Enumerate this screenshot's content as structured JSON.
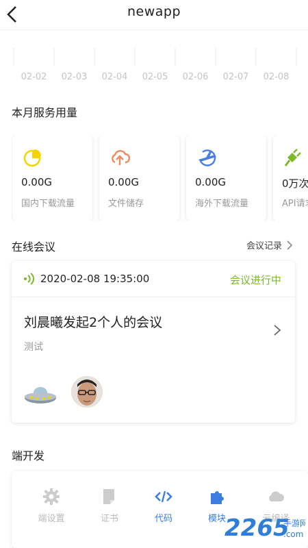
{
  "header": {
    "title": "newapp"
  },
  "chart": {
    "dates": [
      "02-02",
      "02-03",
      "02-04",
      "02-05",
      "02-06",
      "02-07",
      "02-08"
    ]
  },
  "usage": {
    "title": "本月服务用量",
    "cards": [
      {
        "value": "0.00G",
        "label": "国内下载流量",
        "icon": "pie-chart-icon",
        "color": "#f5d300"
      },
      {
        "value": "0.00G",
        "label": "文件储存",
        "icon": "cloud-upload-icon",
        "color": "#f08a5d"
      },
      {
        "value": "0.00G",
        "label": "海外下载流量",
        "icon": "globe-plane-icon",
        "color": "#4a7fe0"
      },
      {
        "value": "0万次",
        "label": "API请求",
        "icon": "plug-icon",
        "color": "#7bb928"
      }
    ]
  },
  "meeting": {
    "title": "在线会议",
    "link": "会议记录",
    "time": "2020-02-08 19:35:00",
    "status": "会议进行中",
    "name": "刘晨曦发起2个人的会议",
    "subtitle": "测试",
    "status_color": "#7bb928"
  },
  "dev": {
    "title": "端开发",
    "items": [
      {
        "label": "端设置",
        "icon": "gear-icon",
        "color": "#cccccc"
      },
      {
        "label": "证书",
        "icon": "certificate-icon",
        "color": "#cccccc"
      },
      {
        "label": "代码",
        "icon": "code-icon",
        "color": "#3b7ee0"
      },
      {
        "label": "模块",
        "icon": "puzzle-icon",
        "color": "#3b7ee0"
      },
      {
        "label": "云编译",
        "icon": "cloud-icon",
        "color": "#cccccc"
      }
    ]
  },
  "watermark": {
    "text": "2265",
    "sub": "手游网",
    "url": ".com"
  }
}
